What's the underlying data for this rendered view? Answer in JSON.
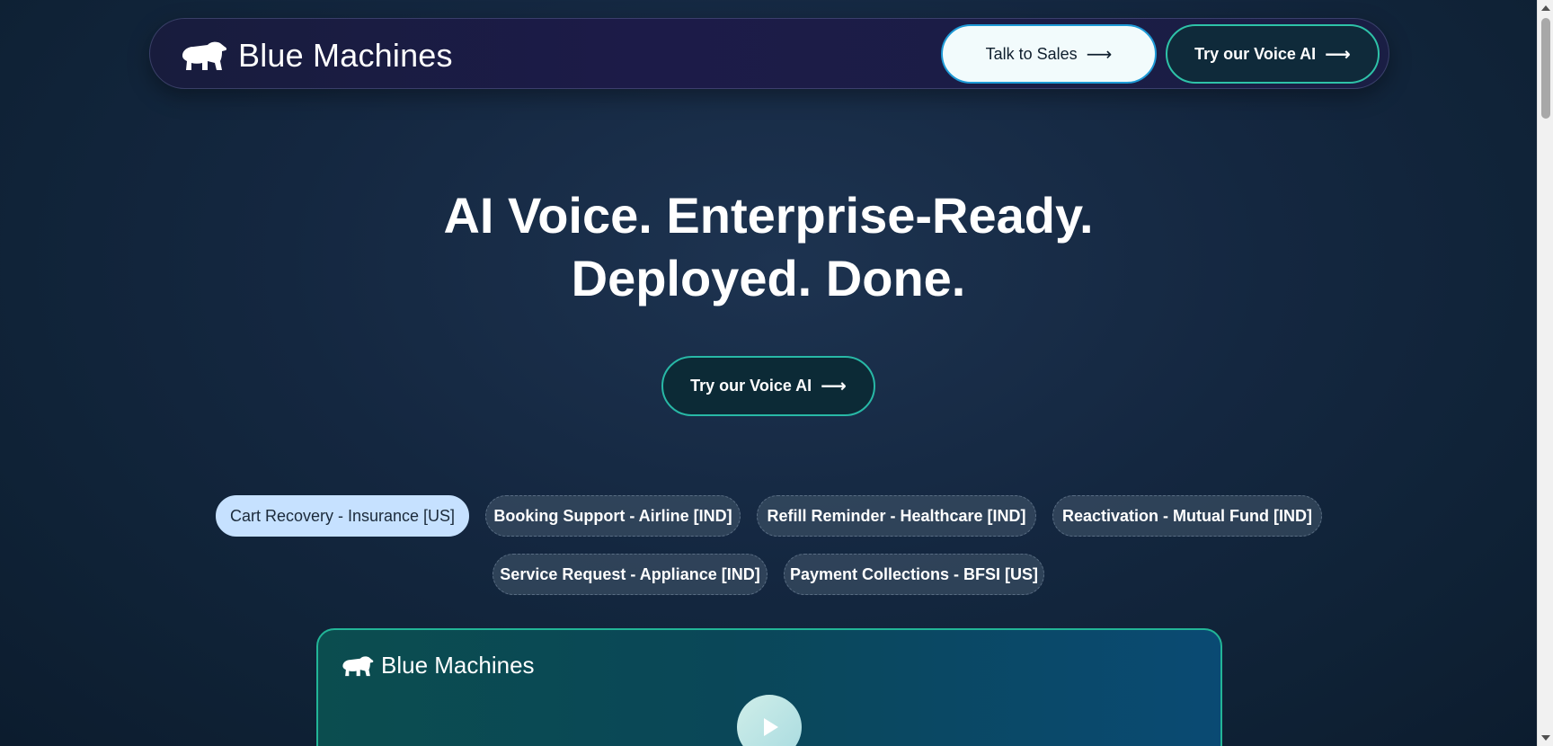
{
  "header": {
    "brand": "Blue Machines",
    "talk_to_sales": "Talk to Sales",
    "try_voice": "Try our Voice AI",
    "arrow": "⟶"
  },
  "hero": {
    "title_line1": "AI Voice. Enterprise-Ready.",
    "title_line2": "Deployed. Done.",
    "cta": "Try our Voice AI",
    "arrow": "⟶"
  },
  "chips": [
    {
      "label": "Cart Recovery - Insurance [US]",
      "active": true
    },
    {
      "label": "Booking Support - Airline [IND]",
      "active": false
    },
    {
      "label": "Refill Reminder - Healthcare [IND]",
      "active": false
    },
    {
      "label": "Reactivation - Mutual Fund [IND]",
      "active": false
    },
    {
      "label": "Service Request - Appliance [IND]",
      "active": false
    },
    {
      "label": "Payment Collections - BFSI [US]",
      "active": false
    }
  ],
  "video_card": {
    "brand": "Blue Machines"
  },
  "colors": {
    "accent_teal": "#2ec2a8",
    "accent_blue": "#1e9ad6",
    "active_chip": "#c6e1ff"
  }
}
